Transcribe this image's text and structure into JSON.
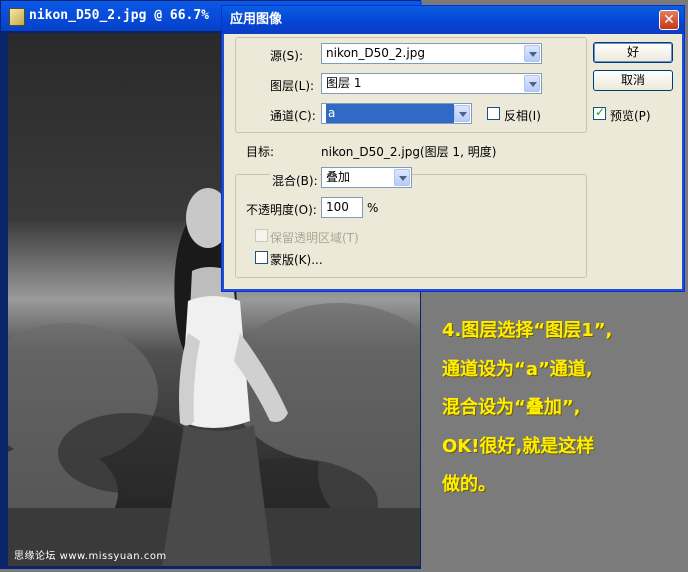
{
  "image_window": {
    "title": "nikon_D50_2.jpg @ 66.7%",
    "watermark": "思缘论坛 www.missyuan.com"
  },
  "dialog": {
    "title": "应用图像",
    "close_icon": "close-icon",
    "source": {
      "label": "源(S):",
      "value": "nikon_D50_2.jpg"
    },
    "layer": {
      "label": "图层(L):",
      "value": "图层 1"
    },
    "channel": {
      "label": "通道(C):",
      "value": "a"
    },
    "invert": {
      "label": "反相(I)",
      "checked": false
    },
    "target": {
      "label": "目标:",
      "value": "nikon_D50_2.jpg(图层 1, 明度)"
    },
    "blending": {
      "label": "混合(B):",
      "value": "叠加"
    },
    "opacity": {
      "label": "不透明度(O):",
      "value": "100",
      "unit": "%"
    },
    "preserve_transparency": {
      "label": "保留透明区域(T)",
      "checked": false,
      "enabled": false
    },
    "mask": {
      "label": "蒙版(K)...",
      "checked": false
    },
    "ok_button": "好",
    "cancel_button": "取消",
    "preview": {
      "label": "预览(P)",
      "checked": true
    }
  },
  "annotation": {
    "lines": [
      "4.图层选择“图层1”,",
      "通道设为“a”通道,",
      "混合设为“叠加”,",
      "OK!很好,就是这样",
      "做的。"
    ]
  },
  "colors": {
    "titlebar_blue": "#0a58e8",
    "dialog_bg": "#ece9d8",
    "annotation_yellow": "#ffee00",
    "background_gray": "#7b7b7b"
  }
}
